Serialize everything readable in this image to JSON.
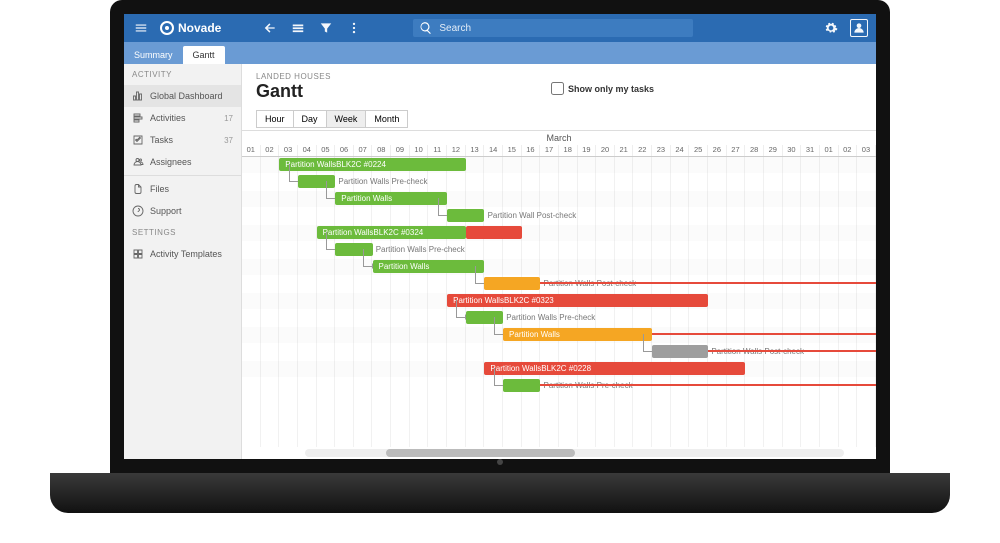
{
  "brand": "Novade",
  "topbar": {
    "search_placeholder": "Search"
  },
  "tabs": [
    {
      "label": "Summary",
      "active": false
    },
    {
      "label": "Gantt",
      "active": true
    }
  ],
  "sidebar": {
    "section_activity": "ACTIVITY",
    "section_settings": "SETTINGS",
    "items": [
      {
        "icon": "dashboard",
        "label": "Global Dashboard",
        "count": "",
        "active": true
      },
      {
        "icon": "activities",
        "label": "Activities",
        "count": "17",
        "active": false
      },
      {
        "icon": "tasks",
        "label": "Tasks",
        "count": "37",
        "active": false
      },
      {
        "icon": "assignees",
        "label": "Assignees",
        "count": "",
        "active": false
      }
    ],
    "items2": [
      {
        "icon": "files",
        "label": "Files"
      },
      {
        "icon": "support",
        "label": "Support"
      }
    ],
    "items3": [
      {
        "icon": "templates",
        "label": "Activity Templates"
      }
    ]
  },
  "content": {
    "breadcrumb": "LANDED HOUSES",
    "title": "Gantt",
    "show_only": "Show only my tasks",
    "zoom": [
      "Hour",
      "Day",
      "Week",
      "Month"
    ],
    "zoom_active": "Week"
  },
  "gantt": {
    "month": "March",
    "days": [
      "01",
      "02",
      "03",
      "04",
      "05",
      "06",
      "07",
      "08",
      "09",
      "10",
      "11",
      "12",
      "13",
      "14",
      "15",
      "16",
      "17",
      "18",
      "19",
      "20",
      "21",
      "22",
      "23",
      "24",
      "25",
      "26",
      "27",
      "28",
      "29",
      "30",
      "31",
      "01",
      "02",
      "03"
    ],
    "rows": [
      {
        "bars": [
          {
            "type": "green",
            "start": 2,
            "end": 12,
            "label": "Partition WallsBLK2C #0224",
            "arrows": "lr"
          }
        ]
      },
      {
        "dep_from_prev": true,
        "bars": [
          {
            "type": "green",
            "start": 3,
            "end": 5,
            "outlabel": "Partition Walls Pre-check"
          }
        ]
      },
      {
        "dep_from_prev": true,
        "bars": [
          {
            "type": "green",
            "start": 5,
            "end": 11,
            "label": "Partition Walls",
            "arrows": "r"
          }
        ]
      },
      {
        "dep_from_prev": true,
        "bars": [
          {
            "type": "green",
            "start": 11,
            "end": 13,
            "outlabel": "Partition Wall Post-check"
          }
        ]
      },
      {
        "bars": [
          {
            "type": "green",
            "start": 4,
            "end": 12,
            "label": "Partition WallsBLK2C #0324",
            "arrows": "lr"
          },
          {
            "type": "red",
            "start": 12,
            "end": 15,
            "arrows": "r"
          }
        ]
      },
      {
        "dep_from_prev": true,
        "bars": [
          {
            "type": "green",
            "start": 5,
            "end": 7,
            "outlabel": "Partition Walls Pre-check"
          }
        ]
      },
      {
        "dep_from_prev": true,
        "bars": [
          {
            "type": "green",
            "start": 7,
            "end": 13,
            "label": "Partition Walls",
            "arrows": "r"
          }
        ]
      },
      {
        "dep_from_prev": true,
        "bars": [
          {
            "type": "amber",
            "start": 13,
            "end": 16,
            "outlabel": "Partition Walls Post-check"
          }
        ],
        "redline_at": 16
      },
      {
        "bars": [
          {
            "type": "red",
            "start": 11,
            "end": 25,
            "label": "Partition WallsBLK2C #0323",
            "arrows": "lr"
          }
        ]
      },
      {
        "dep_from_prev": true,
        "bars": [
          {
            "type": "green",
            "start": 12,
            "end": 14,
            "outlabel": "Partition Walls Pre-check"
          }
        ]
      },
      {
        "dep_from_prev": true,
        "bars": [
          {
            "type": "amber",
            "start": 14,
            "end": 22,
            "label": "Partition Walls",
            "arrows": "r"
          }
        ],
        "redline_at": 22
      },
      {
        "dep_from_prev": true,
        "bars": [
          {
            "type": "gray",
            "start": 22,
            "end": 25,
            "outlabel": "Partition Walls Post-check"
          }
        ],
        "redline_at": 25
      },
      {
        "bars": [
          {
            "type": "red",
            "start": 13,
            "end": 27,
            "label": "Partition WallsBLK2C #0228",
            "arrows": "lr"
          }
        ]
      },
      {
        "dep_from_prev": true,
        "bars": [
          {
            "type": "green",
            "start": 14,
            "end": 16,
            "outlabel": "Partition Walls Pre-check"
          }
        ],
        "redline_at": 16
      }
    ]
  }
}
